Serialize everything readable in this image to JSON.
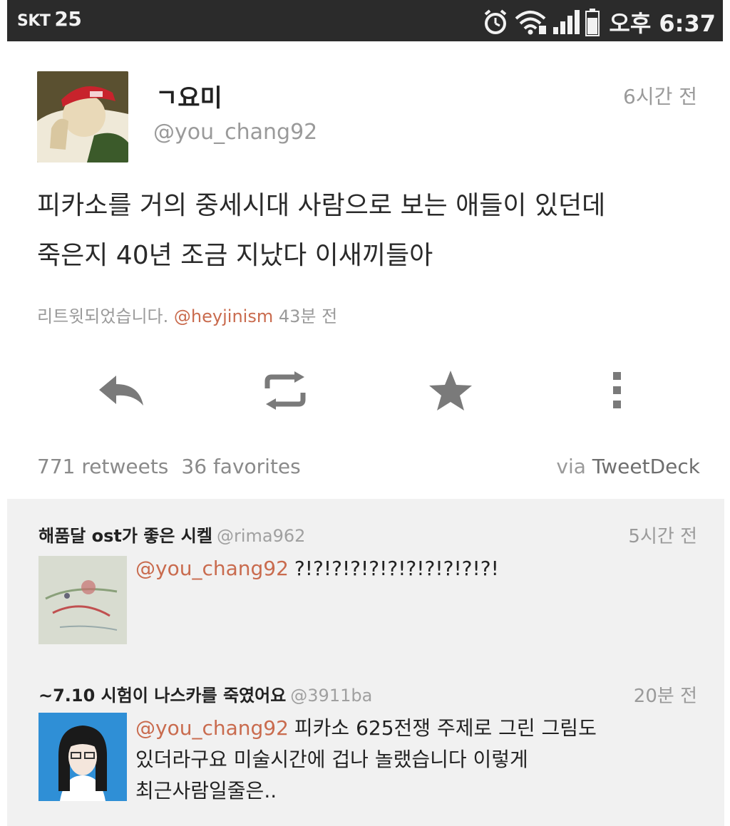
{
  "status_bar": {
    "carrier": "SKT",
    "temperature": "25",
    "time": "오후 6:37",
    "icons": [
      "alarm-icon",
      "wifi-icon",
      "signal-icon",
      "battery-icon"
    ]
  },
  "tweet": {
    "author_name": "ㄱ요미",
    "author_handle": "@you_chang92",
    "time": "6시간 전",
    "text_line1": "피카소를 거의 중세시대 사람으로 보는 애들이 있던데",
    "text_line2": "죽은지 40년 조금 지났다 이새끼들아",
    "retweet_prefix": "리트윗되었습니다.",
    "retweet_user": "@heyjinism",
    "retweet_time": "43분 전",
    "retweets_count": "771",
    "retweets_label": "retweets",
    "favorites_count": "36",
    "favorites_label": "favorites",
    "via_label": "via",
    "via_client": "TweetDeck",
    "actions": [
      "reply-icon",
      "retweet-icon",
      "favorite-icon",
      "more-icon"
    ]
  },
  "replies": [
    {
      "name": "해품달 ost가 좋은 시켈",
      "handle": "@rima962",
      "time": "5시간 전",
      "mention": "@you_chang92",
      "text": "?!?!?!?!?!?!?!?!?!?!?!"
    },
    {
      "name": "~7.10 시험이 나스카를 죽였어요",
      "handle": "@3911ba",
      "time": "20분 전",
      "mention": "@you_chang92",
      "text_line1": "피카소 625전쟁 주제로 그린 그림도",
      "text_line2": "있더라구요 미술시간에 겁나 놀랬습니다 이렇게",
      "text_line3": "최근사람일줄은.."
    }
  ],
  "colors": {
    "status_bar_bg": "#2b2b2b",
    "mention": "#c96b4e",
    "muted": "#9a9a9a",
    "reply_bg": "#f1f1f1",
    "icon": "#7a7a7a"
  }
}
